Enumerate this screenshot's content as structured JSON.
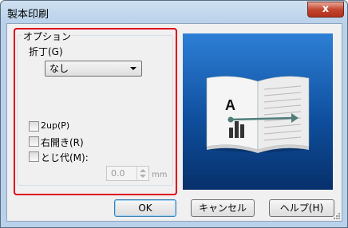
{
  "window": {
    "title": "製本印刷",
    "close_symbol": "x"
  },
  "options": {
    "group_label": "オプション",
    "fold_label": "折丁(G)",
    "fold_value": "なし",
    "two_up_label": "2up(P)",
    "two_up_checked": false,
    "right_open_label": "右開き(R)",
    "right_open_checked": false,
    "binding_label": "とじ代(M):",
    "binding_checked": false,
    "binding_value": "0.0",
    "binding_unit": "mm"
  },
  "preview": {
    "letter": "A"
  },
  "buttons": {
    "ok": "OK",
    "cancel": "キャンセル",
    "help": "ヘルプ(H)"
  },
  "colors": {
    "highlight": "#e0001a",
    "preview_bg": "#1a5fb4",
    "arrow": "#4f7d7a"
  }
}
